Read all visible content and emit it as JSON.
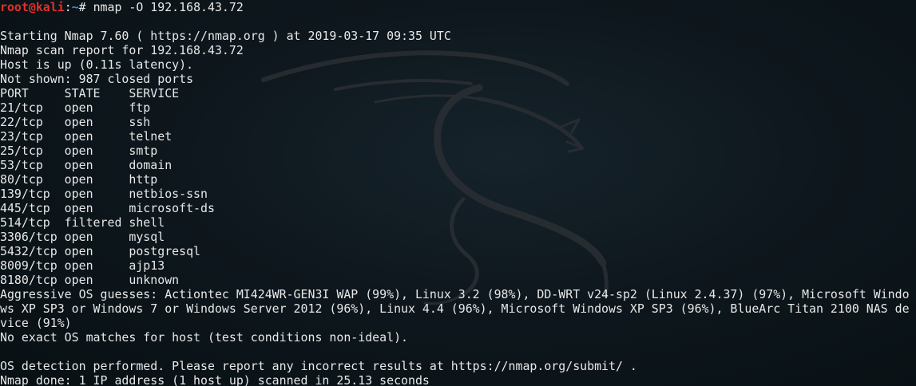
{
  "prompt": {
    "user_host": "root@kali",
    "sep": ":",
    "path": "~",
    "symbol": "# ",
    "command": "nmap -O 192.168.43.72"
  },
  "output_lines": [
    "",
    "Starting Nmap 7.60 ( https://nmap.org ) at 2019-03-17 09:35 UTC",
    "Nmap scan report for 192.168.43.72",
    "Host is up (0.11s latency).",
    "Not shown: 987 closed ports",
    "PORT     STATE    SERVICE",
    "21/tcp   open     ftp",
    "22/tcp   open     ssh",
    "23/tcp   open     telnet",
    "25/tcp   open     smtp",
    "53/tcp   open     domain",
    "80/tcp   open     http",
    "139/tcp  open     netbios-ssn",
    "445/tcp  open     microsoft-ds",
    "514/tcp  filtered shell",
    "3306/tcp open     mysql",
    "5432/tcp open     postgresql",
    "8009/tcp open     ajp13",
    "8180/tcp open     unknown",
    "Aggressive OS guesses: Actiontec MI424WR-GEN3I WAP (99%), Linux 3.2 (98%), DD-WRT v24-sp2 (Linux 2.4.37) (97%), Microsoft Windo",
    "ws XP SP3 or Windows 7 or Windows Server 2012 (96%), Linux 4.4 (96%), Microsoft Windows XP SP3 (96%), BlueArc Titan 2100 NAS de",
    "vice (91%)",
    "No exact OS matches for host (test conditions non-ideal).",
    "",
    "OS detection performed. Please report any incorrect results at https://nmap.org/submit/ .",
    "Nmap done: 1 IP address (1 host up) scanned in 25.13 seconds"
  ],
  "colors": {
    "background": "#0e171d",
    "text": "#e8e8e8",
    "prompt_user": "#e0302c",
    "prompt_path": "#4a86e8"
  },
  "icons": {
    "background_logo": "kali-dragon-icon"
  }
}
